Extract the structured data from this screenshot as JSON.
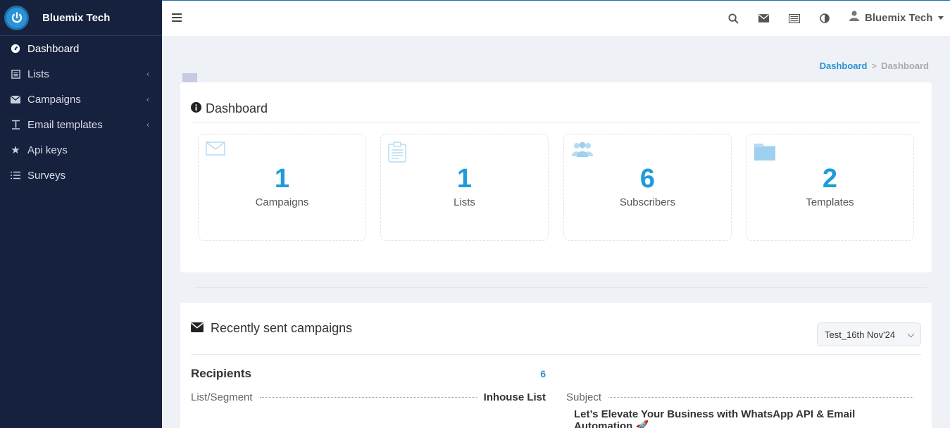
{
  "brand": {
    "name": "Bluemix Tech",
    "logo_icon": "power-icon"
  },
  "sidebar": {
    "items": [
      {
        "label": "Dashboard",
        "icon": "dashboard-icon",
        "active": true
      },
      {
        "label": "Lists",
        "icon": "list-icon"
      },
      {
        "label": "Campaigns",
        "icon": "envelope-icon"
      },
      {
        "label": "Email templates",
        "icon": "text-icon"
      },
      {
        "label": "Api keys",
        "icon": "star-icon"
      },
      {
        "label": "Surveys",
        "icon": "list-lines-icon"
      }
    ]
  },
  "topbar": {
    "user_name": "Bluemix Tech"
  },
  "breadcrumb": {
    "link": "Dashboard",
    "separator": ">",
    "current": "Dashboard"
  },
  "dashboard": {
    "title": "Dashboard",
    "stats": [
      {
        "value": "1",
        "label": "Campaigns",
        "icon": "envelope-icon"
      },
      {
        "value": "1",
        "label": "Lists",
        "icon": "clipboard-icon"
      },
      {
        "value": "6",
        "label": "Subscribers",
        "icon": "users-icon"
      },
      {
        "value": "2",
        "label": "Templates",
        "icon": "folder-icon"
      }
    ]
  },
  "recent": {
    "title": "Recently sent campaigns",
    "selected_campaign": "Test_16th Nov'24",
    "recipients_label": "Recipients",
    "recipients_count": "6",
    "list_segment_label": "List/Segment",
    "list_segment_value": "Inhouse List",
    "subject_label": "Subject",
    "subject_value": "Let’s Elevate Your Business with WhatsApp API & Email Automation 🚀"
  },
  "colors": {
    "sidebar_bg": "#16213e",
    "accent": "#1d9bdc",
    "page_bg": "#eef1f5"
  }
}
